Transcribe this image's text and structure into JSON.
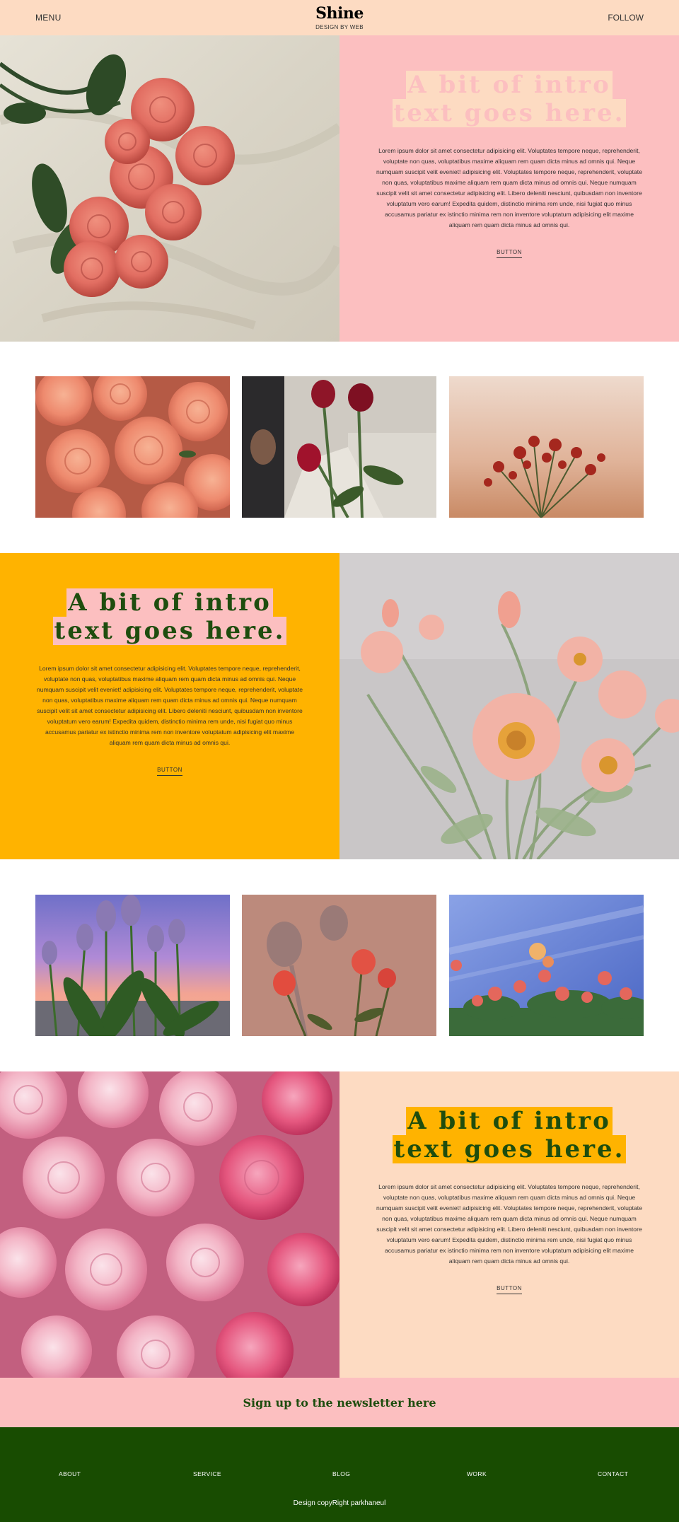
{
  "header": {
    "menu_label": "MENU",
    "logo": "Shine",
    "tagline": "DESIGN BY WEB",
    "follow_label": "FOLLOW"
  },
  "sections": [
    {
      "headline": "A bit of intro text goes here.",
      "body": "Lorem ipsum dolor sit amet consectetur adipisicing elit. Voluptates tempore neque, reprehenderit, voluptate non quas, voluptatibus maxime aliquam rem quam dicta minus ad omnis qui. Neque numquam suscipit velit eveniet! adipisicing elit. Voluptates tempore neque, reprehenderit, voluptate non quas, voluptatibus maxime aliquam rem quam dicta minus ad omnis qui. Neque numquam suscipit velit sit amet consectetur adipisicing elit. Libero deleniti nesciunt, quibusdam non inventore voluptatum vero earum! Expedita quidem, distinctio minima rem unde, nisi fugiat quo minus accusamus pariatur ex istinctio minima rem non inventore voluptatum adipisicing elit maxime aliquam rem quam dicta minus ad omnis qui.",
      "button_label": "BUTTON",
      "panel_color": "#fcbfc0",
      "headline_color": "#fcbfc0",
      "highlight_color": "#fddbc2"
    },
    {
      "headline": "A bit of intro text goes here.",
      "body": "Lorem ipsum dolor sit amet consectetur adipisicing elit. Voluptates tempore neque, reprehenderit, voluptate non quas, voluptatibus maxime aliquam rem quam dicta minus ad omnis qui. Neque numquam suscipit velit eveniet! adipisicing elit. Voluptates tempore neque, reprehenderit, voluptate non quas, voluptatibus maxime aliquam rem quam dicta minus ad omnis qui. Neque numquam suscipit velit sit amet consectetur adipisicing elit. Libero deleniti nesciunt, quibusdam non inventore voluptatum vero earum! Expedita quidem, distinctio minima rem unde, nisi fugiat quo minus accusamus pariatur ex istinctio minima rem non inventore voluptatum adipisicing elit maxime aliquam rem quam dicta minus ad omnis qui.",
      "button_label": "BUTTON",
      "panel_color": "#ffb300",
      "headline_color": "#1e4d0e",
      "highlight_color": "#fcbfc0"
    },
    {
      "headline": "A bit of intro text goes here.",
      "body": "Lorem ipsum dolor sit amet consectetur adipisicing elit. Voluptates tempore neque, reprehenderit, voluptate non quas, voluptatibus maxime aliquam rem quam dicta minus ad omnis qui. Neque numquam suscipit velit eveniet! adipisicing elit. Voluptates tempore neque, reprehenderit, voluptate non quas, voluptatibus maxime aliquam rem quam dicta minus ad omnis qui. Neque numquam suscipit velit sit amet consectetur adipisicing elit. Libero deleniti nesciunt, quibusdam non inventore voluptatum vero earum! Expedita quidem, distinctio minima rem unde, nisi fugiat quo minus accusamus pariatur ex istinctio minima rem non inventore voluptatum adipisicing elit maxime aliquam rem quam dicta minus ad omnis qui.",
      "button_label": "BUTTON",
      "panel_color": "#fddbc2",
      "headline_color": "#1e4d0e",
      "highlight_color": "#ffb300"
    }
  ],
  "newsletter": {
    "label": "Sign up to the newsletter here"
  },
  "footer": {
    "nav": [
      "ABOUT",
      "SERVICE",
      "BLOG",
      "WORK",
      "CONTACT"
    ],
    "copyright": "Design copyRight parkhaneul"
  },
  "colors": {
    "header_bg": "#fddbc2",
    "newsletter_bg": "#fcbfc0",
    "footer_bg": "#184c01"
  }
}
